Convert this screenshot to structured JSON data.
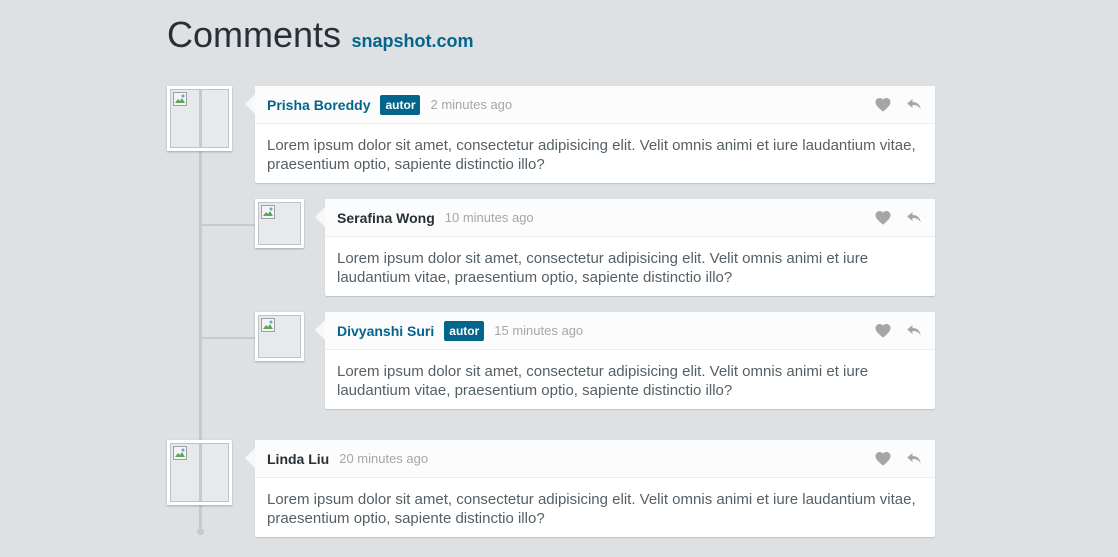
{
  "header": {
    "title": "Comments",
    "site": "snapshot.com"
  },
  "badge_label": "autor",
  "comments": [
    {
      "author": "Prisha Boreddy",
      "is_author": true,
      "time": "2 minutes ago",
      "text": "Lorem ipsum dolor sit amet, consectetur adipisicing elit. Velit omnis animi et iure laudantium vitae, praesentium optio, sapiente distinctio illo?"
    },
    {
      "author": "Serafina Wong",
      "is_author": false,
      "time": "10 minutes ago",
      "text": "Lorem ipsum dolor sit amet, consectetur adipisicing elit. Velit omnis animi et iure laudantium vitae, praesentium optio, sapiente distinctio illo?"
    },
    {
      "author": "Divyanshi Suri",
      "is_author": true,
      "time": "15 minutes ago",
      "text": "Lorem ipsum dolor sit amet, consectetur adipisicing elit. Velit omnis animi et iure laudantium vitae, praesentium optio, sapiente distinctio illo?"
    },
    {
      "author": "Linda Liu",
      "is_author": false,
      "time": "20 minutes ago",
      "text": "Lorem ipsum dolor sit amet, consectetur adipisicing elit. Velit omnis animi et iure laudantium vitae, praesentium optio, sapiente distinctio illo?"
    }
  ],
  "colors": {
    "background": "#dee1e4",
    "accent": "#03658c",
    "icon": "#a6a6a6"
  },
  "icons": {
    "like": "heart-icon",
    "reply": "reply-icon",
    "avatar_placeholder": "broken-image-icon"
  }
}
